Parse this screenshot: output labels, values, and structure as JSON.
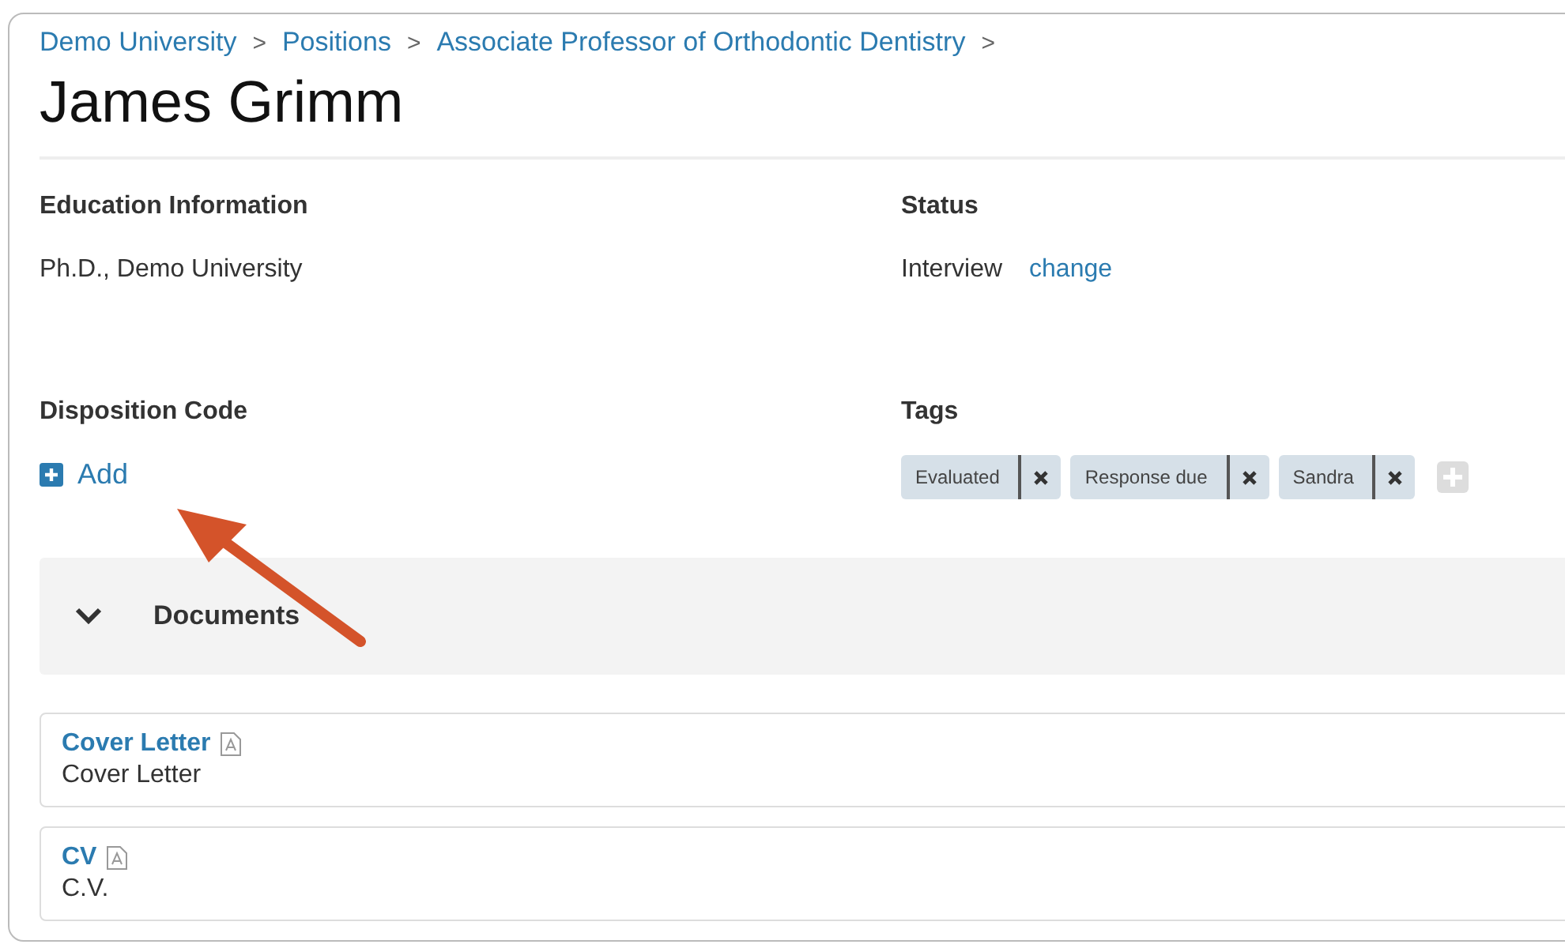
{
  "breadcrumb": [
    {
      "label": "Demo University"
    },
    {
      "label": "Positions"
    },
    {
      "label": "Associate Professor of Orthodontic Dentistry"
    }
  ],
  "breadcrumb_separator": ">",
  "title": "James Grimm",
  "education": {
    "label": "Education Information",
    "value": "Ph.D., Demo University"
  },
  "status": {
    "label": "Status",
    "value": "Interview",
    "action": "change"
  },
  "disposition": {
    "label": "Disposition Code",
    "action": "Add"
  },
  "tags": {
    "label": "Tags",
    "items": [
      {
        "label": "Evaluated"
      },
      {
        "label": "Response due"
      },
      {
        "label": "Sandra"
      }
    ]
  },
  "documents_section": {
    "title": "Documents",
    "expanded": true
  },
  "documents": [
    {
      "name": "Cover Letter",
      "description": "Cover Letter"
    },
    {
      "name": "CV",
      "description": "C.V."
    }
  ]
}
